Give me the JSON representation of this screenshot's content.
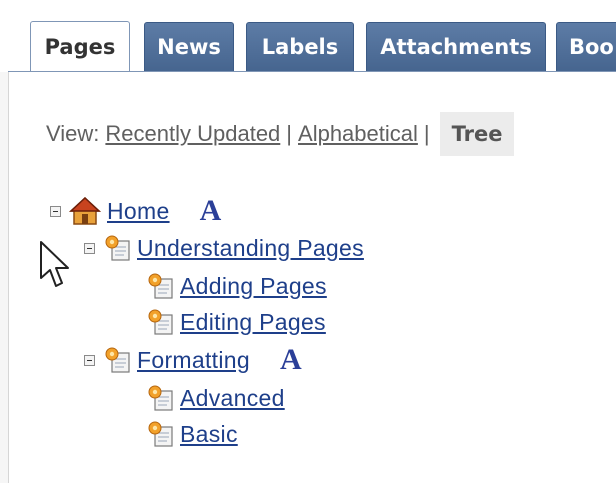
{
  "tabs": [
    {
      "label": "Pages",
      "active": true
    },
    {
      "label": "News",
      "active": false
    },
    {
      "label": "Labels",
      "active": false
    },
    {
      "label": "Attachments",
      "active": false
    },
    {
      "label": "Boo",
      "active": false
    }
  ],
  "view": {
    "label": "View:",
    "recently_updated": "Recently Updated",
    "separator": "|",
    "alphabetical": "Alphabetical",
    "tree": "Tree"
  },
  "tree": {
    "home": "Home",
    "understanding_pages": "Understanding Pages",
    "adding_pages": "Adding Pages",
    "editing_pages": "Editing Pages",
    "formatting": "Formatting",
    "advanced": "Advanced",
    "basic": "Basic",
    "admin_icon_text": "A"
  },
  "colors": {
    "tab_bg": "#4f6f99",
    "link": "#1e3f8a",
    "admin_icon": "#2b3f98"
  }
}
